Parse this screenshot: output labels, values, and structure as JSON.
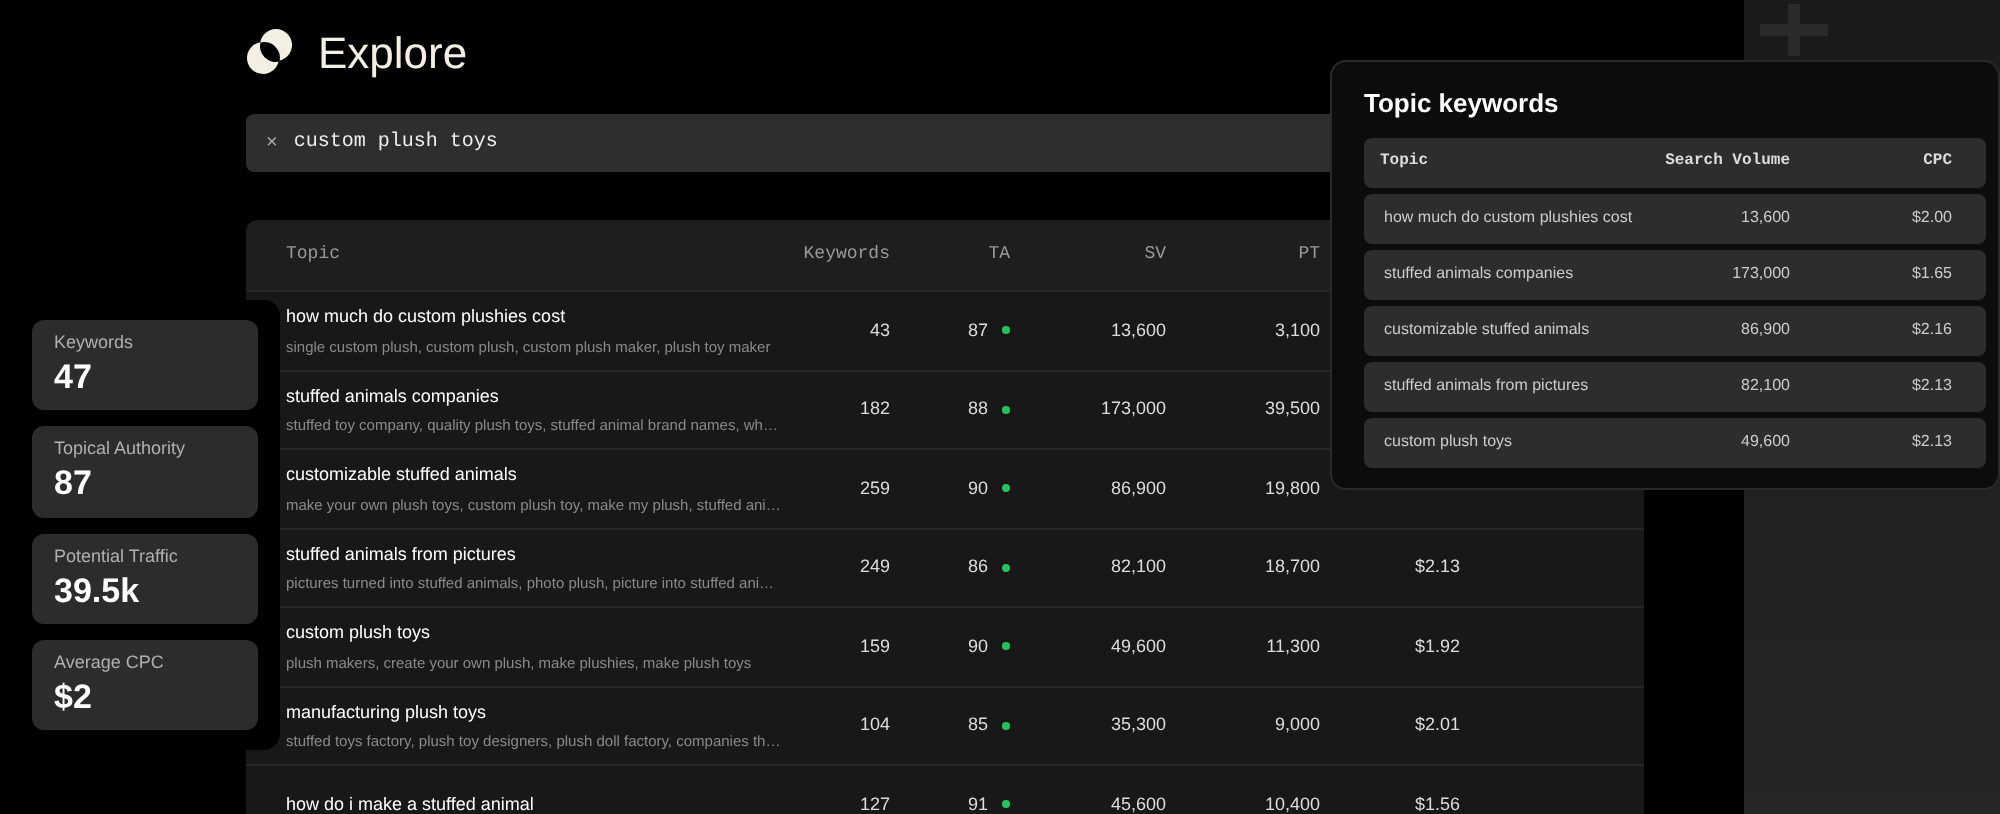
{
  "title": "Explore",
  "search": {
    "value": "custom plush toys",
    "clear": "×"
  },
  "table": {
    "columns": [
      "Topic",
      "Keywords",
      "TA",
      "SV",
      "PT"
    ],
    "rows": [
      {
        "topic": "how much do custom plushies cost",
        "keywords_list": "single custom plush, custom plush, custom plush maker, plush toy maker",
        "keywords": "43",
        "ta": "87",
        "color": "#22c55e",
        "sv": "13,600",
        "pt": "3,100"
      },
      {
        "topic": "stuffed animals companies",
        "keywords_list": "stuffed toy company, quality plush toys, stuffed animal brand names, wh…",
        "keywords": "182",
        "ta": "88",
        "color": "#22c55e",
        "sv": "173,000",
        "pt": "39,500"
      },
      {
        "topic": "customizable stuffed animals",
        "keywords_list": "make your own plush toys, custom plush toy, make my plush, stuffed ani…",
        "keywords": "259",
        "ta": "90",
        "color": "#22c55e",
        "sv": "86,900",
        "pt": "19,800"
      },
      {
        "topic": "stuffed animals from pictures",
        "keywords_list": "pictures turned into stuffed animals, photo plush, picture into stuffed ani…",
        "keywords": "249",
        "ta": "86",
        "color": "#22c55e",
        "sv": "82,100",
        "pt": "18,700",
        "cpc": "$2.13"
      },
      {
        "topic": "custom plush toys",
        "keywords_list": "plush makers, create your own plush, make plushies, make plush toys",
        "keywords": "159",
        "ta": "90",
        "color": "#22c55e",
        "sv": "49,600",
        "pt": "11,300",
        "cpc": "$1.92"
      },
      {
        "topic": "manufacturing plush toys",
        "keywords_list": "stuffed toys factory, plush toy designers, plush doll factory, companies th…",
        "keywords": "104",
        "ta": "85",
        "color": "#22c55e",
        "sv": "35,300",
        "pt": "9,000",
        "cpc": "$2.01"
      },
      {
        "topic": "how do i make a stuffed animal",
        "keywords": "127",
        "ta": "91",
        "color": "#22c55e",
        "sv": "45,600",
        "pt": "10,400",
        "cpc": "$1.56"
      }
    ]
  },
  "stats": [
    {
      "label": "Keywords",
      "value": "47"
    },
    {
      "label": "Topical Authority",
      "value": "87"
    },
    {
      "label": "Potential Traffic",
      "value": "39.5k"
    },
    {
      "label": "Average CPC",
      "value": "$2"
    }
  ],
  "topic_keywords": {
    "title": "Topic keywords",
    "columns": [
      "Topic",
      "Search Volume",
      "CPC"
    ],
    "rows": [
      {
        "topic": "how much do custom plushies cost",
        "search_volume": "13,600",
        "cpc": "$2.00"
      },
      {
        "topic": "stuffed animals companies",
        "search_volume": "173,000",
        "cpc": "$1.65"
      },
      {
        "topic": "customizable stuffed animals",
        "search_volume": "86,900",
        "cpc": "$2.16"
      },
      {
        "topic": "stuffed animals from pictures",
        "search_volume": "82,100",
        "cpc": "$2.13"
      },
      {
        "topic": "custom plush toys",
        "search_volume": "49,600",
        "cpc": "$2.13"
      }
    ]
  }
}
